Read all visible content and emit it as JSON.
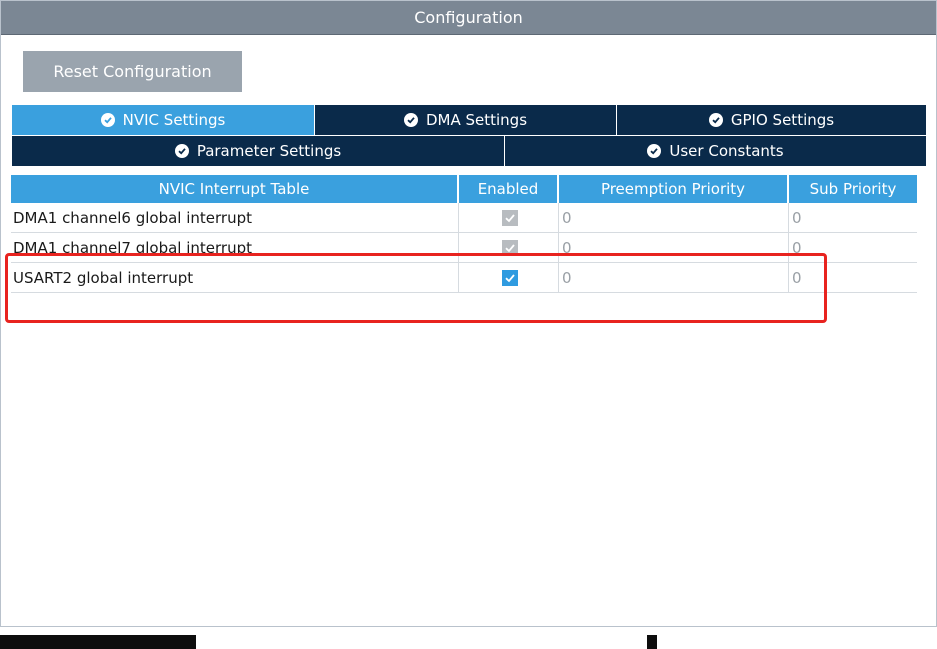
{
  "window": {
    "title": "Configuration"
  },
  "toolbar": {
    "reset_label": "Reset Configuration"
  },
  "tabs_row1": [
    {
      "label": "NVIC Settings",
      "active": true
    },
    {
      "label": "DMA Settings",
      "active": false
    },
    {
      "label": "GPIO Settings",
      "active": false
    }
  ],
  "tabs_row2": [
    {
      "label": "Parameter Settings",
      "active": false
    },
    {
      "label": "User Constants",
      "active": false
    }
  ],
  "table": {
    "headers": [
      "NVIC Interrupt Table",
      "Enabled",
      "Preemption Priority",
      "Sub Priority"
    ],
    "rows": [
      {
        "name": "DMA1 channel6 global interrupt",
        "enabled": true,
        "enabled_editable": false,
        "preemption": "0",
        "sub": "0"
      },
      {
        "name": "DMA1 channel7 global interrupt",
        "enabled": true,
        "enabled_editable": false,
        "preemption": "0",
        "sub": "0"
      },
      {
        "name": "USART2 global interrupt",
        "enabled": true,
        "enabled_editable": true,
        "preemption": "0",
        "sub": "0"
      }
    ]
  },
  "colors": {
    "accent": "#3aa0de",
    "tab_dark": "#0a2a4a",
    "highlight": "#e8231f"
  }
}
